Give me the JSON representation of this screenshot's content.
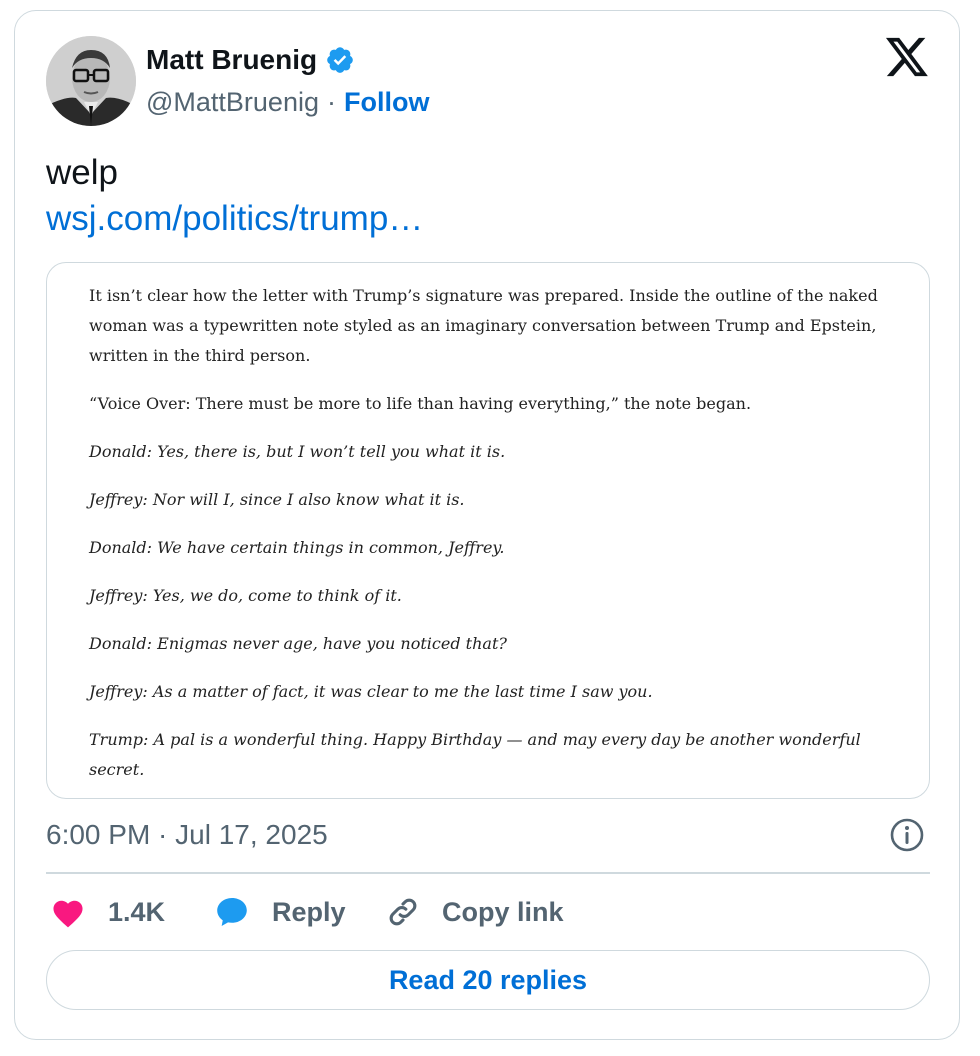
{
  "author": {
    "display_name": "Matt Bruenig",
    "handle": "@MattBruenig",
    "separator": "·",
    "follow_label": "Follow",
    "verified": true
  },
  "tweet": {
    "text": "welp",
    "link_text": "wsj.com/politics/trump…"
  },
  "quote": {
    "paragraphs": [
      {
        "text": "It isn’t clear how the letter with Trump’s signature was prepared. Inside the outline of the naked woman was a typewritten note styled as an imaginary conversation between Trump and Epstein, written in the third person.",
        "italic": false
      },
      {
        "text": "“Voice Over: There must be more to life than having everything,” the note began.",
        "italic": false
      },
      {
        "text": "Donald: Yes, there is, but I won’t tell you what it is.",
        "italic": true
      },
      {
        "text": "Jeffrey: Nor will I, since I also know what it is.",
        "italic": true
      },
      {
        "text": "Donald: We have certain things in common, Jeffrey.",
        "italic": true
      },
      {
        "text": "Jeffrey: Yes, we do, come to think of it.",
        "italic": true
      },
      {
        "text": "Donald: Enigmas never age, have you noticed that?",
        "italic": true
      },
      {
        "text": "Jeffrey: As a matter of fact, it was clear to me the last time I saw you.",
        "italic": true
      },
      {
        "text": "Trump: A pal is a wonderful thing. Happy Birthday — and may every day be another wonderful secret.",
        "italic": true
      }
    ]
  },
  "meta": {
    "timestamp": "6:00 PM · Jul 17, 2025"
  },
  "actions": {
    "like_count": "1.4K",
    "reply_label": "Reply",
    "copy_link_label": "Copy link",
    "read_replies_label": "Read 20 replies"
  },
  "icons": {
    "avatar": "avatar-photo",
    "verified": "verified-badge-icon",
    "logo": "x-logo-icon",
    "info": "info-icon",
    "like": "heart-icon",
    "reply": "speech-bubble-icon",
    "copy": "link-icon"
  },
  "colors": {
    "link": "#006fd6",
    "verified": "#1d9bf0",
    "like": "#f91880",
    "muted": "#536471",
    "border": "#cfd9de"
  }
}
